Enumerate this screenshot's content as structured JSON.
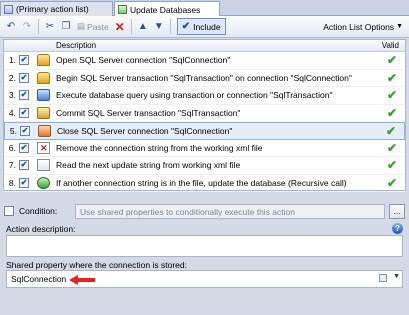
{
  "tabs": [
    {
      "label": "(Primary action list)",
      "active": false
    },
    {
      "label": "Update Databases",
      "active": true
    }
  ],
  "toolbar": {
    "undo_icon": "undo-icon",
    "redo_icon": "redo-icon",
    "cut_icon": "cut-icon",
    "copy_icon": "copy-icon",
    "paste_label": "Paste",
    "delete_icon": "delete-icon",
    "move_up_icon": "arrow-up-icon",
    "move_down_icon": "arrow-down-icon",
    "include_label": "Include",
    "options_label": "Action List Options"
  },
  "grid": {
    "headers": {
      "description": "Description",
      "valid": "Valid"
    },
    "rows": [
      {
        "num": "1.",
        "checked": true,
        "icon": "database-icon",
        "text": "Open SQL Server connection \"SqlConnection\"",
        "valid": true
      },
      {
        "num": "2.",
        "checked": true,
        "icon": "transaction-icon",
        "text": "Begin SQL Server transaction \"SqlTransaction\" on connection \"SqlConnection\"",
        "valid": true
      },
      {
        "num": "3.",
        "checked": true,
        "icon": "execute-query-icon",
        "text": "Execute database query using transaction or connection \"SqlTransaction\"",
        "valid": true
      },
      {
        "num": "4.",
        "checked": true,
        "icon": "commit-icon",
        "text": "Commit SQL Server transaction \"SqlTransaction\"",
        "valid": true
      },
      {
        "num": "5.",
        "checked": true,
        "icon": "close-connection-icon",
        "text": "Close SQL Server connection \"SqlConnection\"",
        "valid": true,
        "selected": true
      },
      {
        "num": "6.",
        "checked": true,
        "icon": "remove-icon",
        "text": "Remove the connection string from the working xml file",
        "valid": true
      },
      {
        "num": "7.",
        "checked": true,
        "icon": "read-icon",
        "text": "Read the next update string from working xml file",
        "valid": true
      },
      {
        "num": "8.",
        "checked": true,
        "icon": "if-icon",
        "text": "If another connection string is in the file, update the database (Recursive call)",
        "valid": true
      }
    ]
  },
  "condition": {
    "label": "Condition:",
    "checked": false,
    "placeholder": "Use shared properties to conditionally execute this action",
    "button_label": "..."
  },
  "action_description": {
    "label": "Action description:",
    "value": "",
    "help_icon": "help-icon"
  },
  "shared_property": {
    "label": "Shared property where the connection is stored:",
    "value": "SqlConnection"
  },
  "colors": {
    "accent": "#8fb2e3",
    "valid": "#3aa12c",
    "annotation_arrow": "#e52222"
  }
}
